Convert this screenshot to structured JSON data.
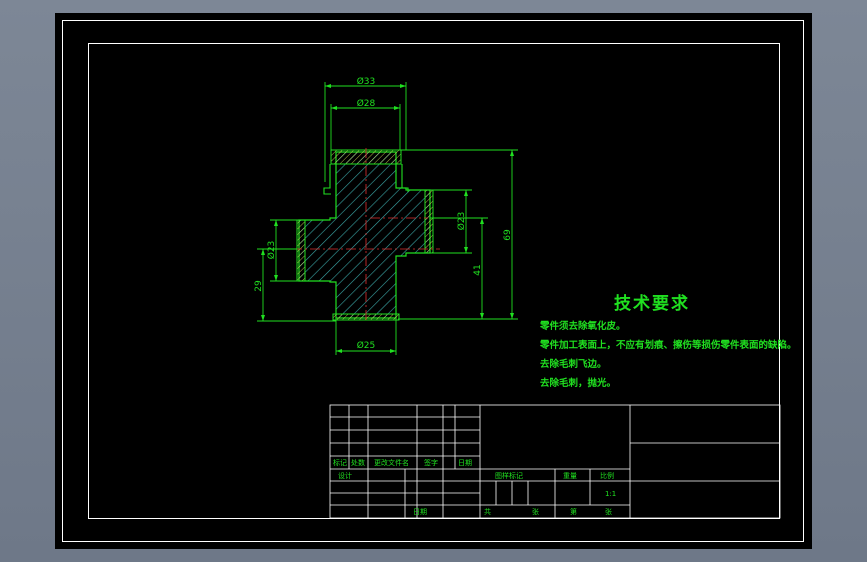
{
  "drawing": {
    "dimensions": {
      "d33": "Ø33",
      "d28": "Ø28",
      "d25": "Ø25",
      "d23_right": "Ø23",
      "d23_left": "Ø23",
      "len69": "69",
      "len41": "41",
      "len29": "29"
    }
  },
  "requirements": {
    "title": "技术要求",
    "lines": [
      "零件须去除氧化皮。",
      "零件加工表面上，不应有划痕、擦伤等损伤零件表面的缺陷。",
      "去除毛刺飞边。",
      "去除毛刺，抛光。"
    ]
  },
  "title_block": {
    "mark": "标记",
    "count": "处数",
    "change_doc": "更改文件名",
    "signature": "签字",
    "date_col": "日期",
    "designer": "设计",
    "date": "日期",
    "stage_mark": "图样标记",
    "weight": "重量",
    "scale": "比例",
    "scale_value": "1:1",
    "total": "共",
    "sheet1": "张",
    "page": "第",
    "sheet2": "张"
  },
  "colors": {
    "outline": "#20e020",
    "dimension": "#20e020",
    "hatch": "#3aa6a6",
    "thread": "#e0e060",
    "centerline": "#e03030",
    "frame": "#ffffff"
  }
}
